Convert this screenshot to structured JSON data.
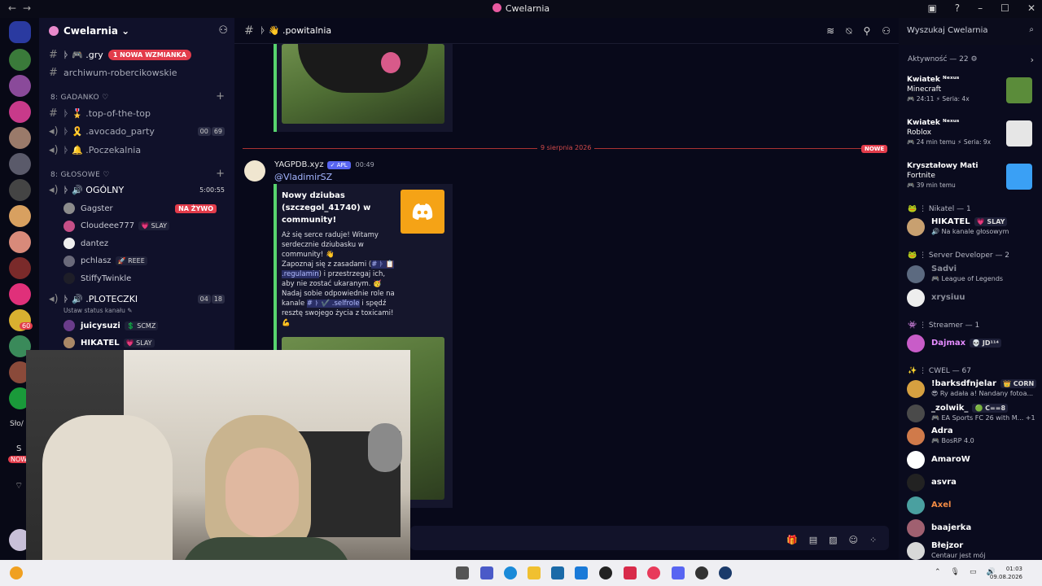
{
  "window": {
    "title": "Cwelarnia"
  },
  "guild": {
    "name": "Cwelarnia"
  },
  "servers": {
    "badges": [
      "60",
      "NOWE"
    ],
    "labels": [
      "Sło/",
      "S"
    ]
  },
  "channels": {
    "gry": {
      "name": "ᚦ 🎮 .gry",
      "mention": "1 NOWA WZMIANKA"
    },
    "archiwum": {
      "name": "archiwum-robercikowskie"
    },
    "cat_gadanko": "8: GADANKO ♡",
    "top": {
      "name": "ᚦ 🎖️ .top-of-the-top"
    },
    "avocado": {
      "name": "ᚦ 🎗️ .avocado_party",
      "pill": [
        "00",
        "69"
      ]
    },
    "poczekalnia": {
      "name": "ᚦ 🔔 .Poczekalnia"
    },
    "cat_glosowe": "8: GŁOSOWE ♡",
    "ogolny": {
      "name": "ᚦ 🔊 OGÓLNY",
      "timer": "5:00:55"
    },
    "ploteczki": {
      "name": "ᚦ 🔊 .PLOTECZKI",
      "pill": [
        "04",
        "18"
      ],
      "status": "Ustaw status kanału ✎"
    }
  },
  "voice_users": [
    {
      "name": "Gagster",
      "live": "NA ŻYWO",
      "color": "#8c8c8c"
    },
    {
      "name": "Cloudeee777",
      "tag": "💗 SLAY",
      "color": "#c64f87"
    },
    {
      "name": "dantez",
      "color": "#eeeeee"
    },
    {
      "name": "pchlasz",
      "tag": "🚀 REEE",
      "color": "#6a6a7a"
    },
    {
      "name": "StiffyTwinkle",
      "color": "#1e1e28"
    }
  ],
  "ploteczki_users": [
    {
      "name": "juicysuzi",
      "tag": "💲 SCMZ",
      "color": "#6a3c8a"
    },
    {
      "name": "ΗΙΚΑΤΕL",
      "tag": "💗 SLAY",
      "color": "#aa8866"
    }
  ],
  "main": {
    "channel_name": "ᚦ 👋 .powitalnia",
    "divider": "9 sierpnia 2026",
    "new_badge": "NOWE",
    "message": {
      "author": "YAGPDB.xyz",
      "app_tag": "✓ APL",
      "time": "00:49",
      "mention": "@VladimirSZ",
      "embed_title": "Nowy dziubas (szczegol_41740) w community!",
      "desc_1": "Aż się serce raduje! Witamy serdecznie dziubasku w community! 👋",
      "desc_2": "Zapoznaj się z zasadami (",
      "chan_1": "# ᚦ 📋 .regulamin",
      "desc_3": ") i przestrzegaj ich, aby nie zostać ukaranym. 🥳",
      "desc_4": "Nadaj sobie odpowiednie role na kanale",
      "chan_2": "# ᚦ ✔️ .selfrole",
      "desc_5": "i spędź resztę swojego życia z toxicami! 💪"
    }
  },
  "search": {
    "placeholder": "Wyszukaj Cwelarnia"
  },
  "members": {
    "activity_header": "Aktywność — 22 ⚙",
    "activities": [
      {
        "user": "Kwiatek ᴺᵉˣᵘˢ",
        "game": "Minecraft",
        "meta": "🎮 24:11   ⚡ Seria: 4x",
        "color": "#5b8c3a"
      },
      {
        "user": "Kwiatek ᴺᵉˣᵘˢ",
        "game": "Roblox",
        "meta": "🎮 24 min temu   ⚡ Seria: 9x",
        "color": "#e6e6e6"
      },
      {
        "user": "Kryształowy Mati",
        "game": "Fortnite",
        "meta": "🎮 39 min temu",
        "color": "#3aa0f5"
      }
    ],
    "groups": [
      {
        "header": "🐸 ⋮ Nikatel — 1"
      },
      {
        "header": "🐸 ⋮ Server Developer — 2"
      },
      {
        "header": "👾 ⋮ Streamer — 1"
      },
      {
        "header": "✨ ⋮ CWEL — 67"
      }
    ],
    "list": [
      {
        "name": "ΗΙΚΑΤΕL",
        "tag": "💗 SLAY",
        "activity": "🔊 Na kanale głosowym",
        "color": "#c8a070",
        "namecolor": "#ffffff"
      },
      {
        "name": "Sadvi",
        "activity": "🎮 League of Legends",
        "color": "#5c6a80",
        "namecolor": "#8a8d99"
      },
      {
        "name": "xrysiuu",
        "activity": "",
        "color": "#eeeeee",
        "namecolor": "#8a8d99"
      },
      {
        "name": "Dajmax",
        "tag": "💀 JD¹¹⁴",
        "activity": "",
        "color": "#c85cc8",
        "namecolor": "#e58cff"
      },
      {
        "name": "!barksdfnjelar",
        "tag": "👑 CORN",
        "activity": "😎 Ry adała a! Nandany fotoa...",
        "color": "#d6a040",
        "namecolor": "#ffffff"
      },
      {
        "name": "_zolwik_",
        "tag": "🟢 C==8",
        "activity": "🎮 EA Sports FC 26 with M...  +1",
        "color": "#4a4a4a",
        "namecolor": "#ffffff"
      },
      {
        "name": "Adra",
        "activity": "🎮 BosRP 4.0",
        "color": "#d07a4a",
        "namecolor": "#ffffff"
      },
      {
        "name": "AmaroW",
        "activity": "",
        "color": "#ffffff",
        "namecolor": "#ffffff"
      },
      {
        "name": "asvra",
        "activity": "",
        "color": "#222222",
        "namecolor": "#ffffff"
      },
      {
        "name": "Axel",
        "activity": "",
        "color": "#4aa0a0",
        "namecolor": "#f28b45"
      },
      {
        "name": "baajerka",
        "activity": "",
        "color": "#a06070",
        "namecolor": "#ffffff"
      },
      {
        "name": "Błejzor",
        "activity": "Centaur jest mój",
        "color": "#d8d8d8",
        "namecolor": "#ffffff"
      }
    ]
  },
  "clock": {
    "time": "01:03",
    "date": "09.08.2026"
  }
}
